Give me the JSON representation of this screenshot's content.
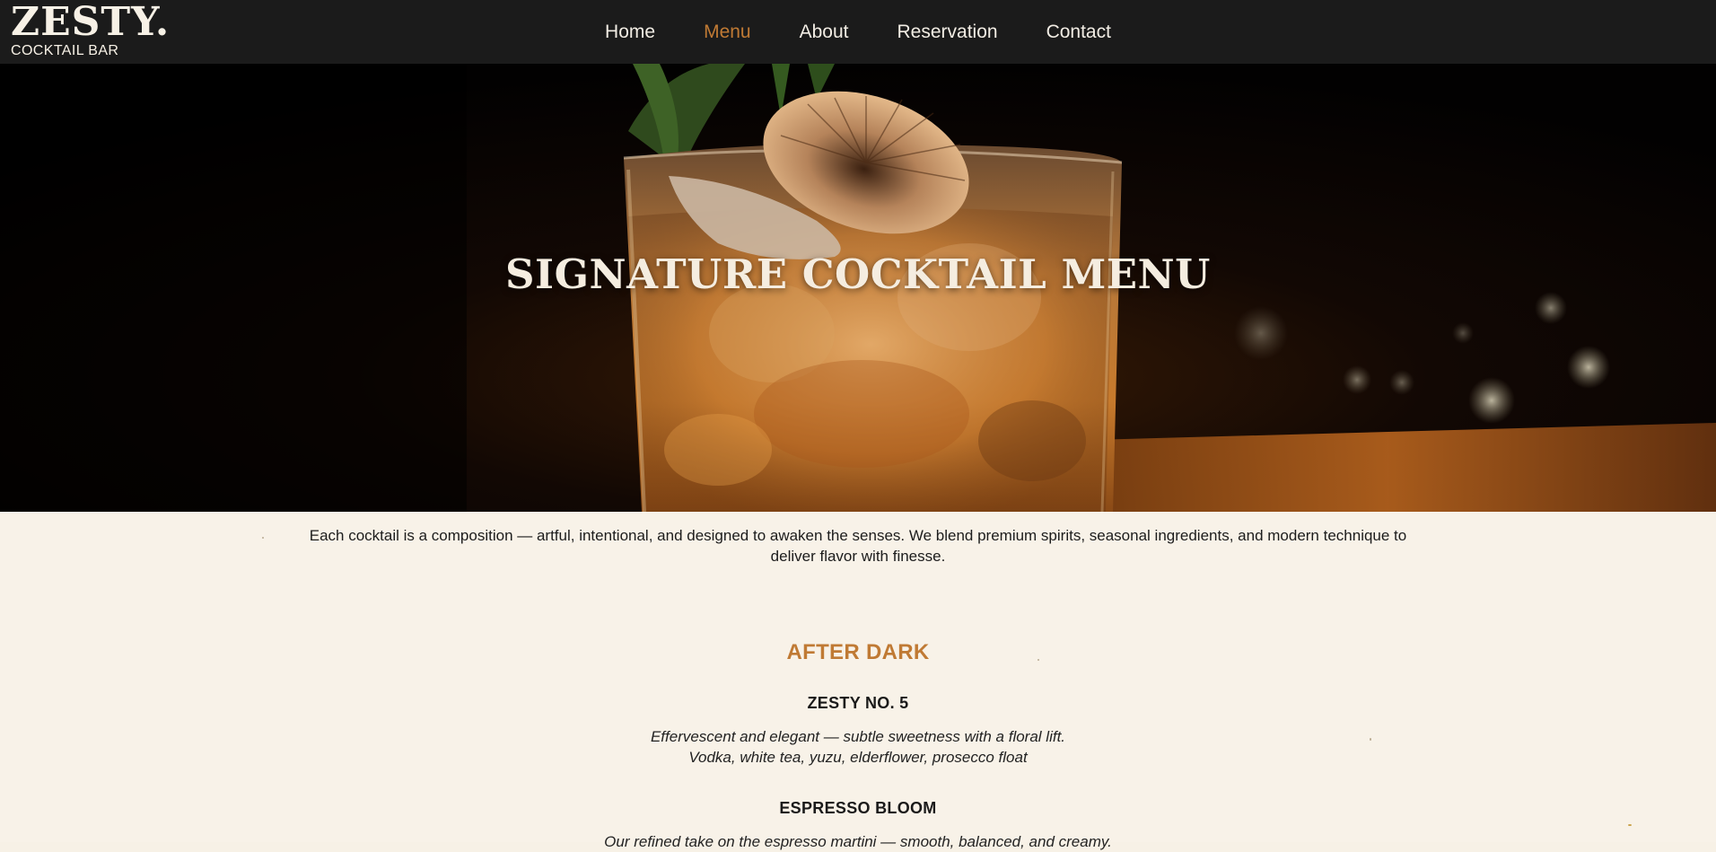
{
  "brand": {
    "name": "ZESTY.",
    "subtitle": "COCKTAIL BAR"
  },
  "nav": {
    "items": [
      {
        "label": "Home",
        "active": false
      },
      {
        "label": "Menu",
        "active": true
      },
      {
        "label": "About",
        "active": false
      },
      {
        "label": "Reservation",
        "active": false
      },
      {
        "label": "Contact",
        "active": false
      }
    ]
  },
  "hero": {
    "title": "SIGNATURE COCKTAIL MENU"
  },
  "intro": {
    "text": "Each cocktail is a composition — artful, intentional, and designed to awaken the senses. We blend premium spirits, seasonal ingredients, and modern technique to deliver flavor with finesse."
  },
  "menu": {
    "section_title": "AFTER DARK",
    "items": [
      {
        "name": "ZESTY NO. 5",
        "description": "Effervescent and elegant — subtle sweetness with a floral lift.",
        "ingredients": "Vodka, white tea, yuzu, elderflower, prosecco float"
      },
      {
        "name": "ESPRESSO BLOOM",
        "description": "Our refined take on the espresso martini — smooth, balanced, and creamy."
      }
    ]
  },
  "colors": {
    "nav_background": "#1b1b1b",
    "accent": "#c07a34",
    "page_background": "#f8f2e8",
    "text": "#1b1b1b"
  }
}
